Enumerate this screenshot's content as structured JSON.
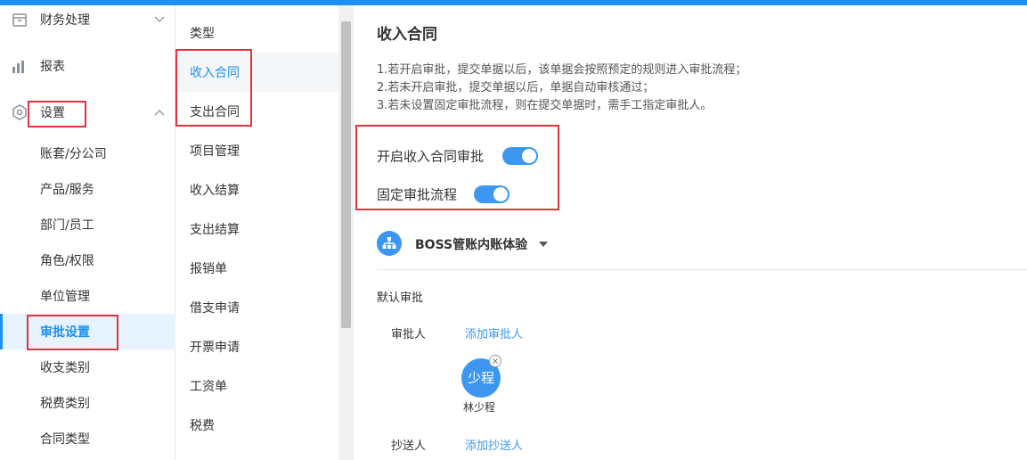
{
  "sidebar": {
    "groups": [
      {
        "label": "财务处理",
        "icon": "finance-icon",
        "expanded": false
      },
      {
        "label": "报表",
        "icon": "report-icon"
      },
      {
        "label": "设置",
        "icon": "settings-icon",
        "expanded": true
      }
    ],
    "settings_items": [
      {
        "label": "账套/分公司"
      },
      {
        "label": "产品/服务"
      },
      {
        "label": "部门/员工"
      },
      {
        "label": "角色/权限"
      },
      {
        "label": "单位管理"
      },
      {
        "label": "审批设置",
        "active": true
      },
      {
        "label": "收支类别"
      },
      {
        "label": "税费类别"
      },
      {
        "label": "合同类型"
      }
    ]
  },
  "types": {
    "header": "类型",
    "items": [
      {
        "label": "收入合同",
        "active": true
      },
      {
        "label": "支出合同"
      },
      {
        "label": "项目管理"
      },
      {
        "label": "收入结算"
      },
      {
        "label": "支出结算"
      },
      {
        "label": "报销单"
      },
      {
        "label": "借支申请"
      },
      {
        "label": "开票申请"
      },
      {
        "label": "工资单"
      },
      {
        "label": "税费"
      }
    ]
  },
  "main": {
    "title": "收入合同",
    "notes": [
      "1.若开启审批，提交单据以后，该单据会按照预定的规则进入审批流程；",
      "2.若未开启审批，提交单据以后，单据自动审核通过；",
      "3.若未设置固定审批流程，则在提交单据时，需手工指定审批人。"
    ],
    "toggles": [
      {
        "label": "开启收入合同审批",
        "on": true
      },
      {
        "label": "固定审批流程",
        "on": true
      }
    ],
    "org": {
      "name": "BOSS管账内账体验",
      "icon": "org-tree-icon"
    },
    "default_approval": {
      "title": "默认审批",
      "approver_label": "审批人",
      "add_approver": "添加审批人",
      "approver": {
        "avatar_text": "少程",
        "name": "林少程"
      },
      "cc_label": "抄送人",
      "add_cc": "添加抄送人"
    }
  },
  "colors": {
    "accent": "#1c90f3",
    "highlight": "#e5323e",
    "active_bg": "#e6f2fd"
  }
}
